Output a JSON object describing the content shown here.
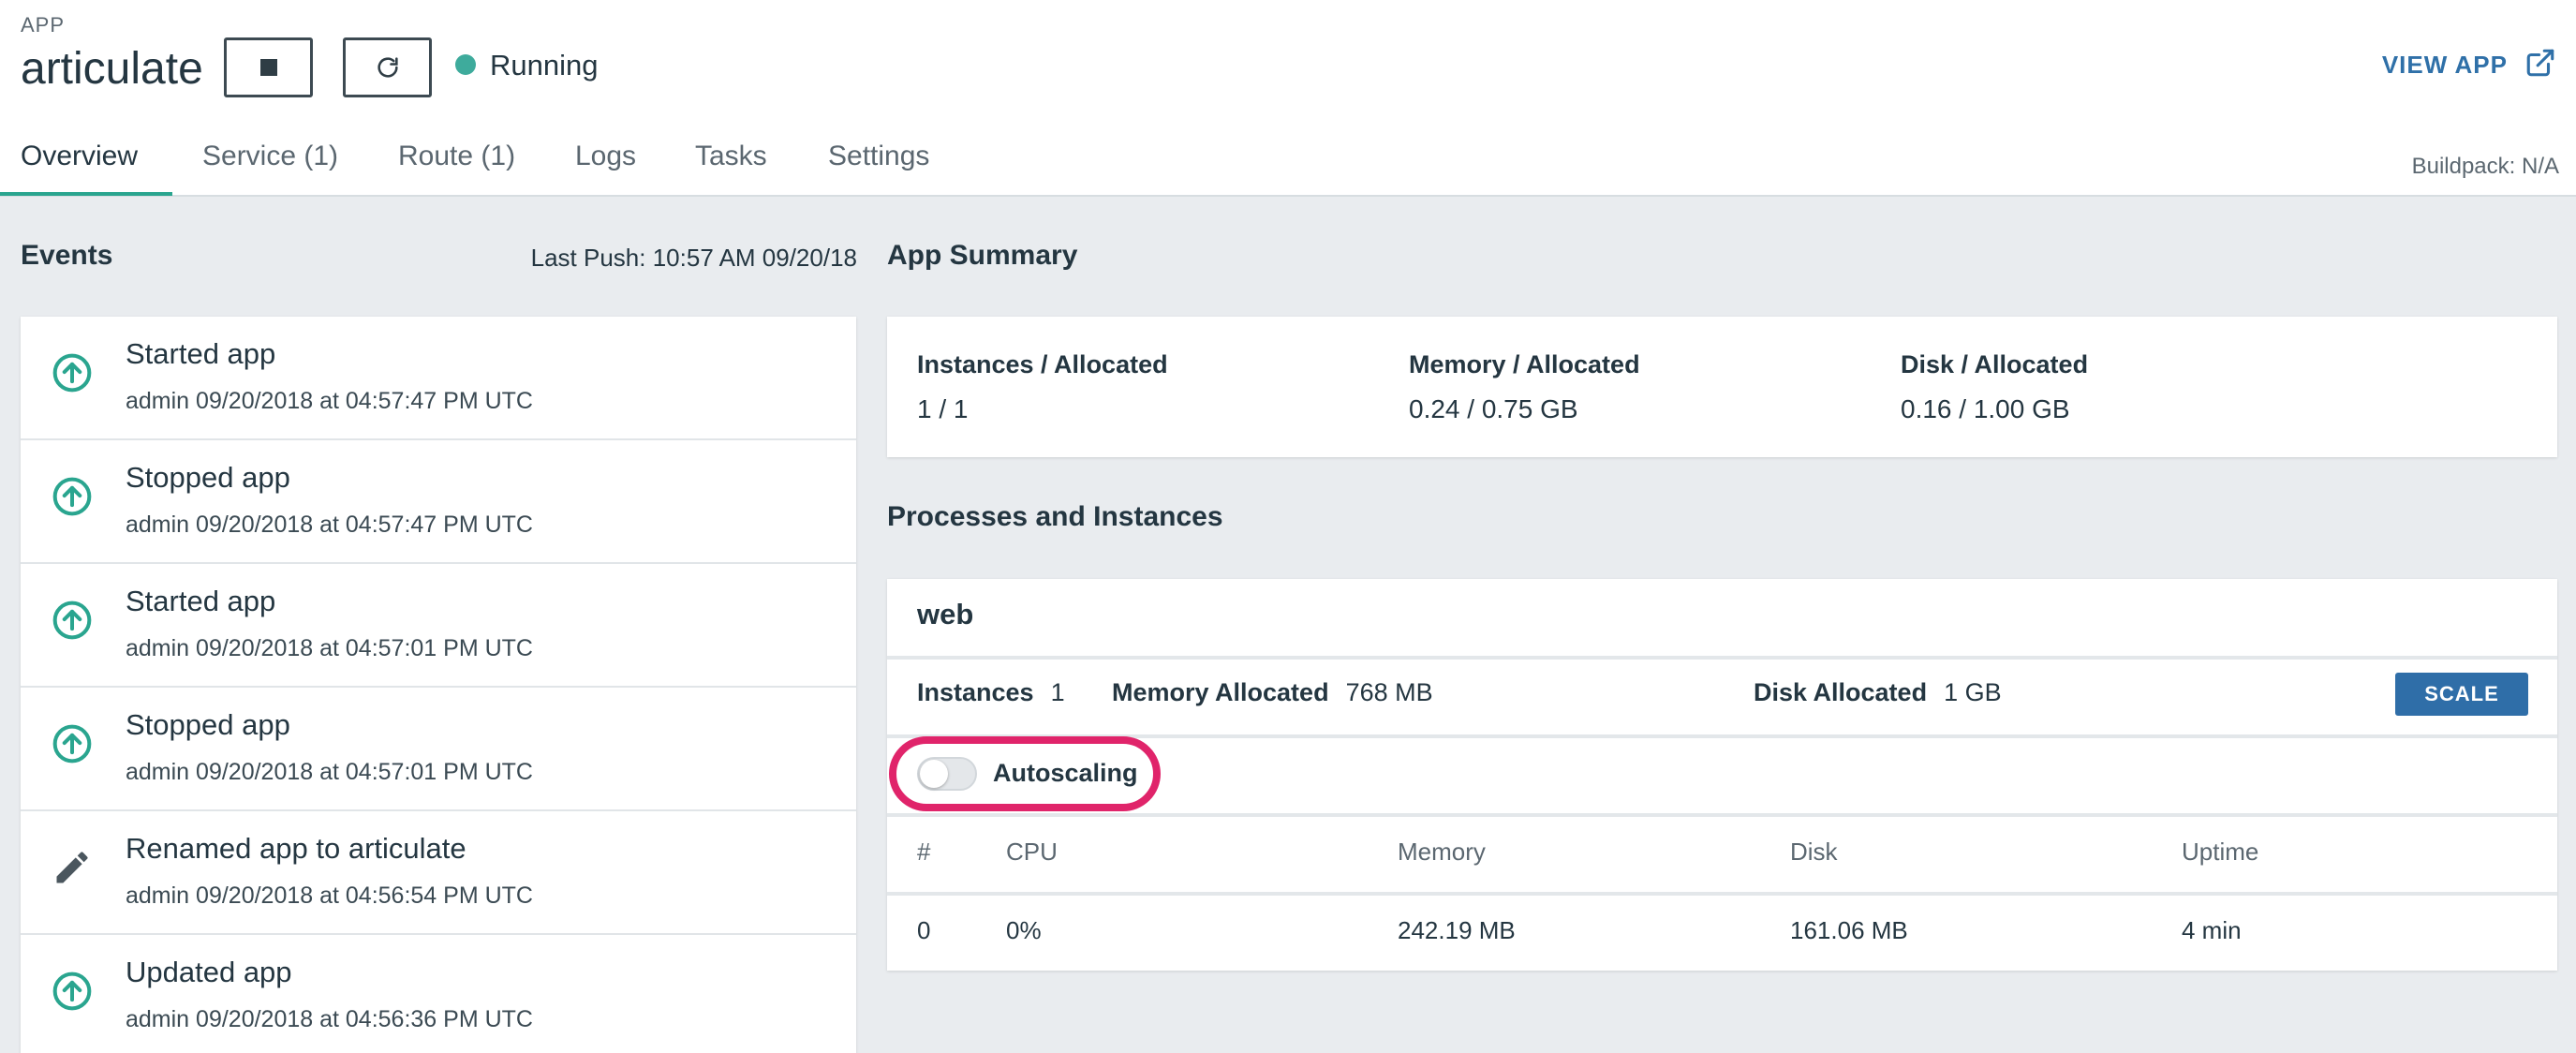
{
  "header": {
    "app_label": "APP",
    "app_name": "articulate",
    "status": "Running",
    "status_color": "#3eab9c",
    "view_app_label": "VIEW APP",
    "buildpack": "Buildpack: N/A",
    "stop_icon": "stop-icon",
    "restart_icon": "restart-icon"
  },
  "tabs": [
    {
      "label": "Overview",
      "active": true
    },
    {
      "label": "Service (1)"
    },
    {
      "label": "Route (1)"
    },
    {
      "label": "Logs"
    },
    {
      "label": "Tasks"
    },
    {
      "label": "Settings"
    }
  ],
  "events": {
    "title": "Events",
    "last_push": "Last Push: 10:57 AM 09/20/18",
    "items": [
      {
        "title": "Started app",
        "meta": "admin 09/20/2018 at 04:57:47 PM UTC",
        "icon": "arrow-up-circle-icon"
      },
      {
        "title": "Stopped app",
        "meta": "admin 09/20/2018 at 04:57:47 PM UTC",
        "icon": "arrow-up-circle-icon"
      },
      {
        "title": "Started app",
        "meta": "admin 09/20/2018 at 04:57:01 PM UTC",
        "icon": "arrow-up-circle-icon"
      },
      {
        "title": "Stopped app",
        "meta": "admin 09/20/2018 at 04:57:01 PM UTC",
        "icon": "arrow-up-circle-icon"
      },
      {
        "title": "Renamed app to articulate",
        "meta": "admin 09/20/2018 at 04:56:54 PM UTC",
        "icon": "pencil-icon"
      },
      {
        "title": "Updated app",
        "meta": "admin 09/20/2018 at 04:56:36 PM UTC",
        "icon": "arrow-up-circle-icon"
      }
    ]
  },
  "summary": {
    "title": "App Summary",
    "instances_label": "Instances / Allocated",
    "instances_value": "1 / 1",
    "memory_label": "Memory / Allocated",
    "memory_value": "0.24 / 0.75 GB",
    "disk_label": "Disk / Allocated",
    "disk_value": "0.16 / 1.00 GB"
  },
  "processes": {
    "title": "Processes and Instances",
    "name": "web",
    "instances_label": "Instances",
    "instances_value": "1",
    "memory_label": "Memory Allocated",
    "memory_value": "768 MB",
    "disk_label": "Disk Allocated",
    "disk_value": "1 GB",
    "scale_label": "SCALE",
    "autoscaling_label": "Autoscaling",
    "autoscaling_enabled": false,
    "columns": [
      "#",
      "CPU",
      "Memory",
      "Disk",
      "Uptime"
    ],
    "rows": [
      [
        "0",
        "0%",
        "242.19 MB",
        "161.06 MB",
        "4 min"
      ]
    ]
  },
  "colors": {
    "accent": "#2aa58f",
    "link": "#2f70a8",
    "highlight": "#e0246a",
    "button": "#2f6ea8"
  }
}
